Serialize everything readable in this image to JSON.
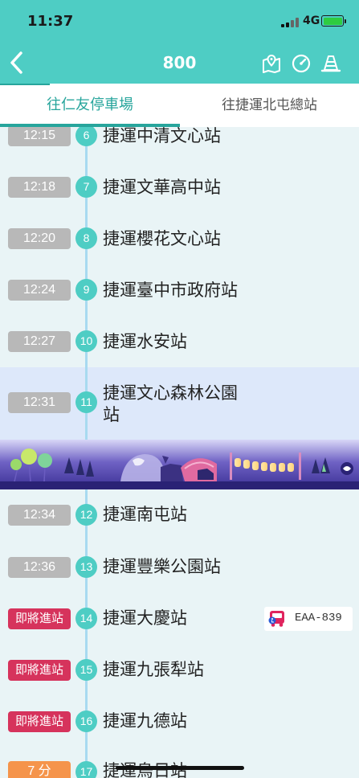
{
  "status": {
    "time": "11:37",
    "network": "4G"
  },
  "header": {
    "title": "800"
  },
  "tabs": [
    {
      "label": "往仁友停車場",
      "active": true
    },
    {
      "label": "往捷運北屯總站",
      "active": false
    }
  ],
  "colors": {
    "accent": "#4ecdc4",
    "tab_active": "#27a59c",
    "eta_gray": "#b8b8b8",
    "eta_arriving": "#d6335c",
    "eta_minutes": "#f5944b",
    "highlight_row": "#dde8fa"
  },
  "stops": [
    {
      "eta": "12:15",
      "num": "6",
      "name": "捷運中清文心站"
    },
    {
      "eta": "12:18",
      "num": "7",
      "name": "捷運文華高中站"
    },
    {
      "eta": "12:20",
      "num": "8",
      "name": "捷運櫻花文心站"
    },
    {
      "eta": "12:24",
      "num": "9",
      "name": "捷運臺中市政府站"
    },
    {
      "eta": "12:27",
      "num": "10",
      "name": "捷運水安站"
    },
    {
      "eta": "12:31",
      "num": "11",
      "name_line1": "捷運文心森林公園",
      "name_line2": "站"
    },
    {
      "eta": "12:34",
      "num": "12",
      "name": "捷運南屯站"
    },
    {
      "eta": "12:36",
      "num": "13",
      "name": "捷運豐樂公園站"
    },
    {
      "eta": "即將進站",
      "num": "14",
      "name": "捷運大慶站",
      "bus_plate": "EAA-839"
    },
    {
      "eta": "即將進站",
      "num": "15",
      "name": "捷運九張犁站"
    },
    {
      "eta": "即將進站",
      "num": "16",
      "name": "捷運九德站"
    },
    {
      "eta": "7 分",
      "num": "17",
      "name": "捷運烏日站"
    }
  ]
}
